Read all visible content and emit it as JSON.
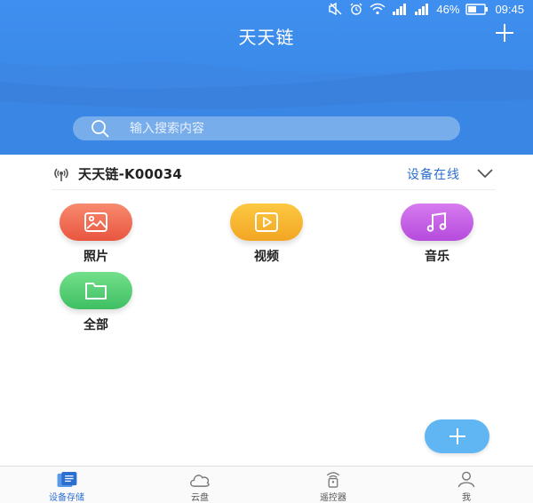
{
  "status_bar": {
    "battery_percent": "46%",
    "time": "09:45"
  },
  "header": {
    "title": "天天链",
    "add_icon": "plus-icon"
  },
  "search": {
    "placeholder": "输入搜索内容",
    "icon": "search-icon"
  },
  "device": {
    "name": "天天链-K00034",
    "status": "设备在线",
    "icon": "wifi-icon"
  },
  "categories": [
    {
      "label": "照片",
      "icon": "image-icon",
      "color_from": "#f78a6e",
      "color_to": "#e9553f"
    },
    {
      "label": "视频",
      "icon": "play-icon",
      "color_from": "#fcc842",
      "color_to": "#f2a623"
    },
    {
      "label": "音乐",
      "icon": "music-icon",
      "color_from": "#d77bf0",
      "color_to": "#b54bdc"
    },
    {
      "label": "全部",
      "icon": "folder-icon",
      "color_from": "#72e08a",
      "color_to": "#3fbf63"
    }
  ],
  "fab": {
    "icon": "plus-icon"
  },
  "bottom_nav": [
    {
      "label": "设备存储",
      "icon": "storage-icon",
      "active": true
    },
    {
      "label": "云盘",
      "icon": "cloud-icon",
      "active": false
    },
    {
      "label": "遥控器",
      "icon": "remote-icon",
      "active": false
    },
    {
      "label": "我",
      "icon": "user-icon",
      "active": false
    }
  ],
  "colors": {
    "header_blue": "#3b8ae9",
    "accent_blue": "#2d6fd1",
    "fab_blue": "#5fb6f3"
  }
}
